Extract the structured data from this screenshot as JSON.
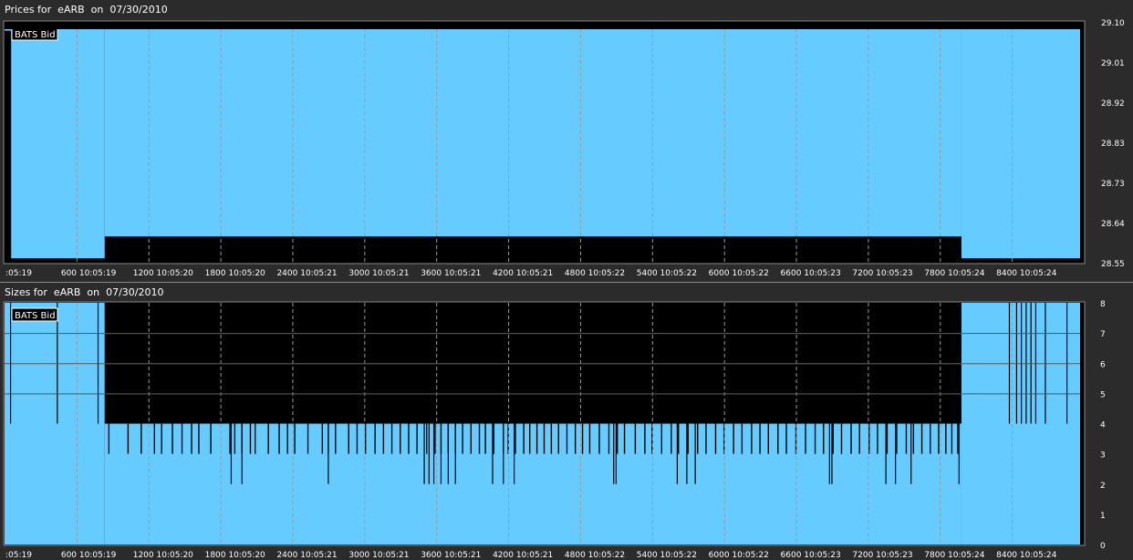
{
  "prices_panel": {
    "title": "Prices for  eARB  on  07/30/2010"
  },
  "sizes_panel": {
    "title": "Sizes for  eARB  on  07/30/2010"
  },
  "colors": {
    "fill": "#66ccff",
    "background": "#000000",
    "grid": "#9a9a9a",
    "text": "#ffffff"
  },
  "chart_data": [
    {
      "type": "area",
      "title": "Prices for  eARB  on  07/30/2010",
      "legend": "BATS Bid",
      "legend_position": "top-left",
      "x_tick_labels": [
        ":05:19",
        "600 10:05:19",
        "1200 10:05:20",
        "1800 10:05:20",
        "2400 10:05:21",
        "3000 10:05:21",
        "3600 10:05:21",
        "4200 10:05:21",
        "4800 10:05:22",
        "5400 10:05:22",
        "6000 10:05:22",
        "6600 10:05:23",
        "7200 10:05:23",
        "7800 10:05:24",
        "8400 10:05:24"
      ],
      "x_ticks": [
        0,
        600,
        1200,
        1800,
        2400,
        3000,
        3600,
        4200,
        4800,
        5400,
        6000,
        6600,
        7200,
        7800,
        8400
      ],
      "xlim": [
        0,
        9000
      ],
      "y_tick_labels": [
        "29.10",
        "29.01",
        "28.92",
        "28.83",
        "28.73",
        "28.64",
        "28.55"
      ],
      "ylim": [
        28.55,
        29.1
      ],
      "grid": "vertical dashed",
      "series": [
        {
          "name": "BATS Bid",
          "segments": [
            {
              "x_start": 0,
              "x_end": 55,
              "y": 29.08
            },
            {
              "x_start": 55,
              "x_end": 835,
              "y": 28.56
            },
            {
              "x_start": 835,
              "x_end": 7980,
              "y": 28.61
            },
            {
              "x_start": 7980,
              "x_end": 9000,
              "y": 28.56
            }
          ]
        }
      ]
    },
    {
      "type": "area",
      "title": "Sizes for  eARB  on  07/30/2010",
      "legend": "BATS Bid",
      "legend_position": "top-left",
      "x_tick_labels": [
        ":05:19",
        "600 10:05:19",
        "1200 10:05:20",
        "1800 10:05:20",
        "2400 10:05:21",
        "3000 10:05:21",
        "3600 10:05:21",
        "4200 10:05:21",
        "4800 10:05:22",
        "5400 10:05:22",
        "6000 10:05:22",
        "6600 10:05:23",
        "7200 10:05:23",
        "7800 10:05:24",
        "8400 10:05:24"
      ],
      "x_ticks": [
        0,
        600,
        1200,
        1800,
        2400,
        3000,
        3600,
        4200,
        4800,
        5400,
        6000,
        6600,
        7200,
        7800,
        8400
      ],
      "xlim": [
        0,
        9000
      ],
      "y_tick_labels": [
        "8",
        "7",
        "6",
        "5",
        "4",
        "3",
        "2",
        "1",
        "0"
      ],
      "ylim": [
        0,
        8
      ],
      "grid": "vertical dashed, horizontal at 5, 6, 7",
      "series": [
        {
          "name": "BATS Bid",
          "segments": [
            {
              "x_start": 0,
              "x_end": 835,
              "y": 8
            },
            {
              "x_start": 835,
              "x_end": 7980,
              "y": 4
            },
            {
              "x_start": 7980,
              "x_end": 9000,
              "y": 8
            }
          ],
          "dips_to_3": [
            870,
            1030,
            1140,
            1250,
            1310,
            1400,
            1480,
            1560,
            1620,
            1720,
            1880,
            1920,
            1980,
            2050,
            2090,
            2200,
            2290,
            2360,
            2420,
            2530,
            2650,
            2700,
            2760,
            2870,
            2940,
            3010,
            3090,
            3160,
            3230,
            3300,
            3370,
            3440,
            3520,
            3590,
            3640,
            3700,
            3760,
            3820,
            3890,
            3960,
            4010,
            4080,
            4160,
            4200,
            4260,
            4330,
            4380,
            4440,
            4500,
            4560,
            4620,
            4690,
            4760,
            4820,
            4880,
            4960,
            5040,
            5110,
            5170,
            5260,
            5340,
            5400,
            5480,
            5560,
            5620,
            5700,
            5780,
            5850,
            5930,
            6000,
            6080,
            6150,
            6230,
            6300,
            6370,
            6450,
            6520,
            6600,
            6680,
            6760,
            6830,
            6910,
            6980,
            7060,
            7130,
            7210,
            7280,
            7360,
            7440,
            7520,
            7580,
            7650,
            7720,
            7790,
            7850,
            7900,
            7950
          ],
          "dips_to_2": [
            1890,
            1980,
            2700,
            3500,
            3540,
            3580,
            3640,
            3700,
            3760,
            4070,
            4160,
            4250,
            5080,
            5100,
            5610,
            5690,
            5760,
            6880,
            6900,
            7350,
            7430,
            7560,
            7960
          ],
          "spikes_to_4": [
            50,
            440,
            780,
            8380,
            8440,
            8480,
            8520,
            8560,
            8600,
            8680,
            8860
          ]
        }
      ]
    }
  ]
}
